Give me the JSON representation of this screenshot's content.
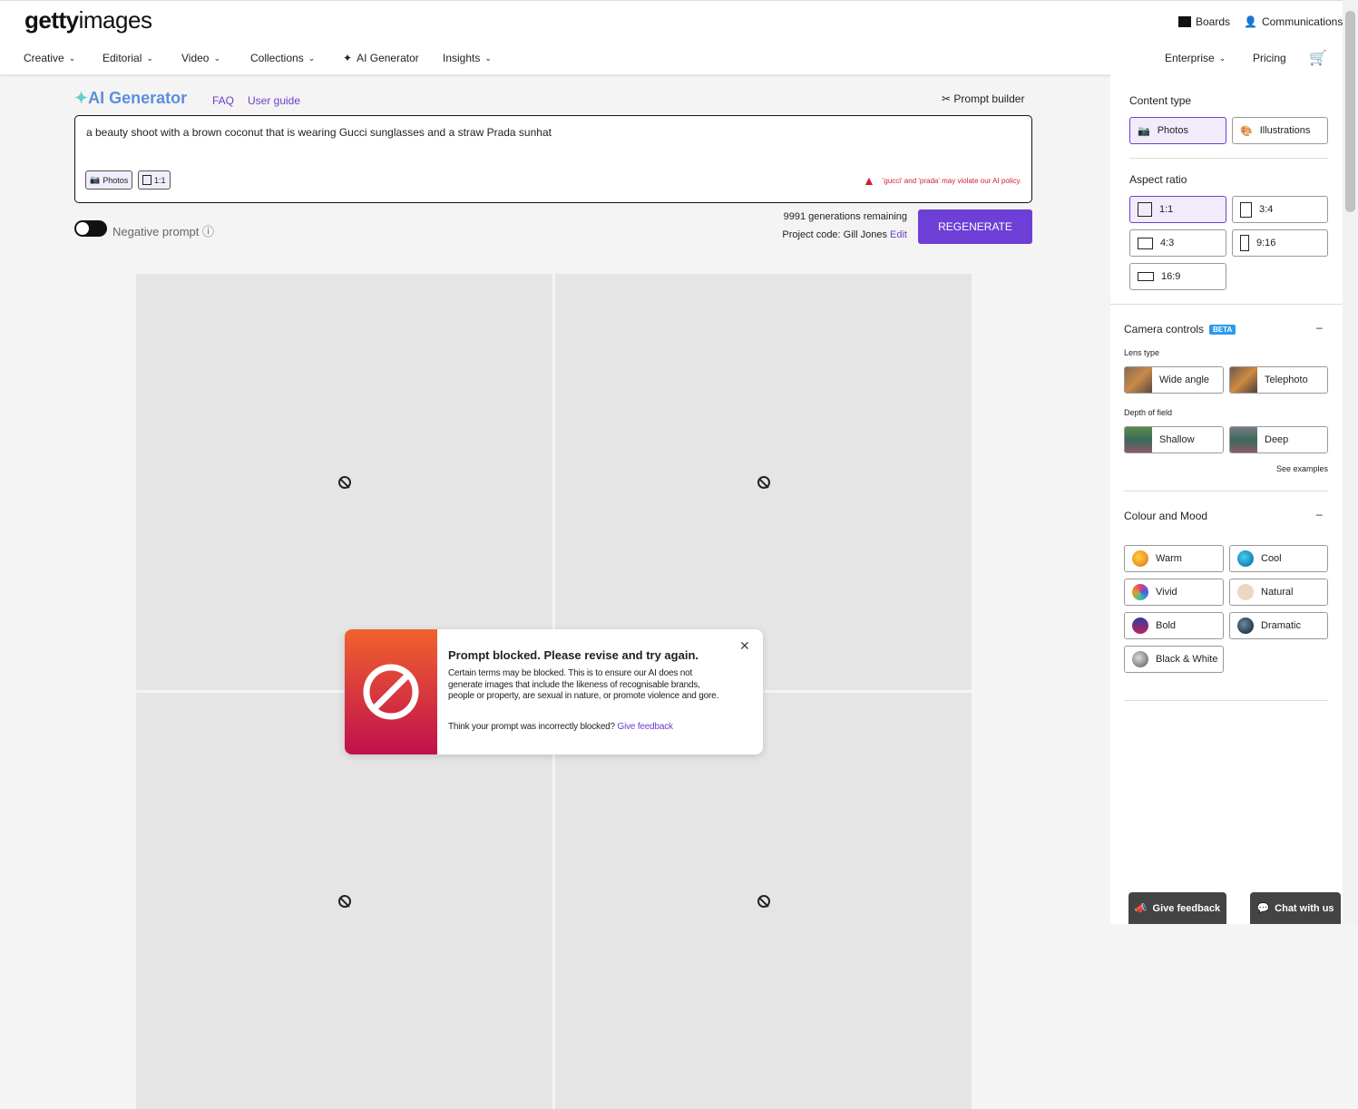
{
  "header": {
    "logo_bold": "getty",
    "logo_light": "images",
    "nav": [
      {
        "label": "Creative"
      },
      {
        "label": "Editorial"
      },
      {
        "label": "Video"
      },
      {
        "label": "Collections"
      },
      {
        "label": "AI Generator"
      },
      {
        "label": "Insights"
      }
    ],
    "boards": "Boards",
    "communications": "Communications",
    "enterprise": "Enterprise",
    "pricing": "Pricing"
  },
  "main": {
    "title": "AI Generator",
    "faq": "FAQ",
    "user_guide": "User guide",
    "prompt_builder": "Prompt builder",
    "prompt_text": "a beauty shoot with a brown coconut that is wearing Gucci sunglasses and a straw Prada sunhat",
    "chip_photos": "Photos",
    "chip_ratio": "1:1",
    "policy_warning": "'gucci' and 'prada' may violate our AI policy.",
    "negative_prompt": "Negative prompt",
    "generations": "9991 generations remaining",
    "project_label": "Project code:",
    "project_value": "Gill Jones",
    "edit": "Edit",
    "regenerate": "REGENERATE"
  },
  "modal": {
    "title": "Prompt blocked. Please revise and try again.",
    "body": "Certain terms may be blocked. This is to ensure our AI does not generate images that include the likeness of recognisable brands, people or property, are sexual in nature, or promote violence and gore.",
    "question": "Think your prompt was incorrectly blocked?",
    "feedback_link": "Give feedback"
  },
  "sidebar": {
    "content_type": "Content type",
    "photos": "Photos",
    "illustrations": "Illustrations",
    "aspect_ratio": "Aspect ratio",
    "ratios": [
      "1:1",
      "3:4",
      "4:3",
      "9:16",
      "16:9"
    ],
    "camera_controls": "Camera controls",
    "beta": "BETA",
    "lens_type": "Lens type",
    "wide": "Wide angle",
    "tele": "Telephoto",
    "depth": "Depth of field",
    "shallow": "Shallow",
    "deep": "Deep",
    "see_examples": "See examples",
    "colour_mood": "Colour and Mood",
    "moods": [
      {
        "label": "Warm",
        "color": "#f0a020"
      },
      {
        "label": "Cool",
        "color": "#1a8fd0"
      },
      {
        "label": "Vivid",
        "color": "#b050c0"
      },
      {
        "label": "Natural",
        "color": "#e8d4b8"
      },
      {
        "label": "Bold",
        "color": "#6a2a80"
      },
      {
        "label": "Dramatic",
        "color": "#2a3a50"
      },
      {
        "label": "Black & White",
        "color": "#888888"
      }
    ]
  },
  "footer": {
    "give_feedback": "Give feedback",
    "chat": "Chat with us"
  },
  "colors": {
    "accent": "#6e3fd6",
    "warning": "#d0202e"
  }
}
